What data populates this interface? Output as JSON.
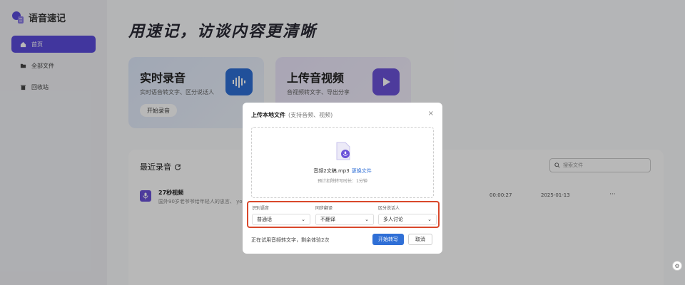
{
  "app": {
    "name": "语音速记"
  },
  "sidebar": {
    "items": [
      {
        "label": "首页",
        "icon": "home-icon",
        "active": true
      },
      {
        "label": "全部文件",
        "icon": "folder-icon",
        "active": false
      },
      {
        "label": "回收站",
        "icon": "trash-icon",
        "active": false
      }
    ]
  },
  "hero": {
    "title": "用速记，访谈内容更清晰"
  },
  "cards": {
    "record": {
      "title": "实时录音",
      "subtitle": "实时语音转文字、区分说话人",
      "button": "开始录音",
      "icon": "audio-wave-icon"
    },
    "upload": {
      "title": "上传音视频",
      "subtitle": "音视频转文字、导出分享",
      "icon": "video-play-icon"
    }
  },
  "recent": {
    "title": "最近录音",
    "search_placeholder": "搜索文件",
    "rows": [
      {
        "name": "27秒视频",
        "desc": "国外90岁老爷爷给年轻人的忠言、 yo",
        "duration": "00:00:27",
        "date": "2025-01-13",
        "more": "···"
      }
    ]
  },
  "modal": {
    "title": "上传本地文件",
    "hint": "(支持音频、视频)",
    "close": "×",
    "file_name": "音频2文稿.mp3",
    "replace_link": "更换文件",
    "estimate": "预计扣除转写时长：1分钟",
    "options": [
      {
        "label": "识别语音",
        "value": "普通话"
      },
      {
        "label": "同步翻译",
        "value": "不翻译"
      },
      {
        "label": "区分说话人",
        "value": "多人讨论"
      }
    ],
    "trial_note": "正在试用音频转文字，剩余体验2次",
    "start_button": "开始转写",
    "cancel_button": "取消"
  },
  "colors": {
    "accent": "#5b4bdb",
    "primary_blue": "#2f6fd6",
    "highlight_border": "#d9482b"
  }
}
